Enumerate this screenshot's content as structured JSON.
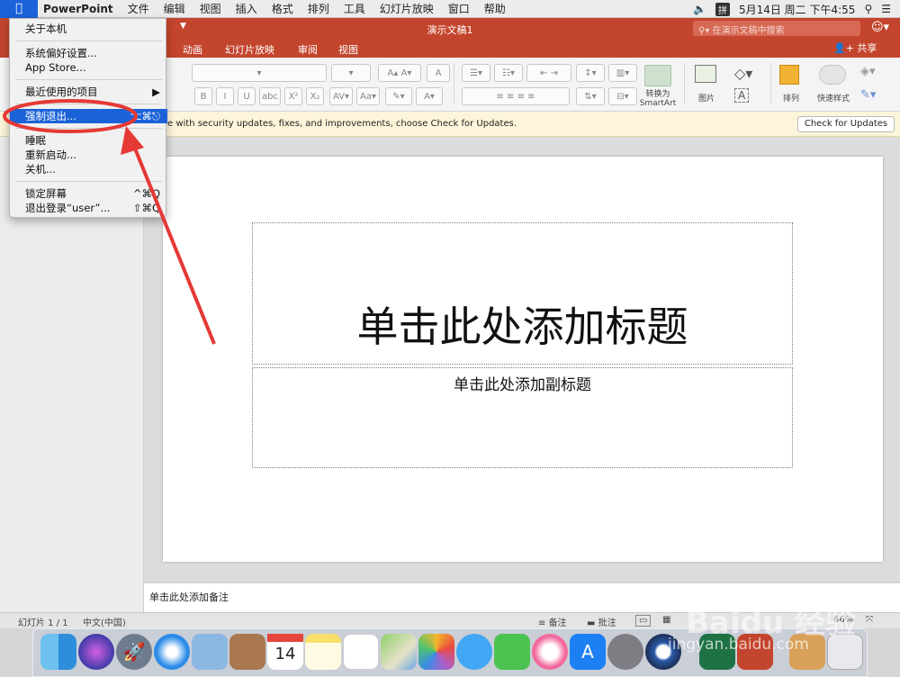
{
  "menubar": {
    "app_name": "PowerPoint",
    "items": [
      "文件",
      "编辑",
      "视图",
      "插入",
      "格式",
      "排列",
      "工具",
      "幻灯片放映",
      "窗口",
      "帮助"
    ],
    "input_method": "拼",
    "datetime": "5月14日 周二 下午4:55"
  },
  "window": {
    "title": "演示文稿1",
    "search_placeholder": "在演示文稿中搜索",
    "share_label": "共享"
  },
  "ribbon": {
    "tabs": [
      "动画",
      "幻灯片放映",
      "审阅",
      "视图"
    ],
    "labels": {
      "convert_smartart": "转换为\nSmartArt",
      "picture": "图片",
      "arrange": "排列",
      "quick_styles": "快速样式"
    },
    "format_buttons": [
      "B",
      "I",
      "U",
      "abc",
      "X²",
      "X₂"
    ]
  },
  "update_bar": {
    "message": "e with security updates, fixes, and improvements, choose Check for Updates.",
    "button": "Check for Updates"
  },
  "slide": {
    "title_placeholder": "单击此处添加标题",
    "subtitle_placeholder": "单击此处添加副标题"
  },
  "notes_placeholder": "单击此处添加备注",
  "status": {
    "slide_counter": "幻灯片 1 / 1",
    "language": "中文(中国)",
    "notes_label": "备注",
    "comments_label": "批注",
    "zoom": "66%"
  },
  "apple_menu": {
    "items": [
      {
        "label": "关于本机",
        "shortcut": ""
      },
      {
        "label": "系统偏好设置...",
        "shortcut": ""
      },
      {
        "label": "App Store...",
        "shortcut": ""
      },
      {
        "label": "最近使用的项目",
        "shortcut": "▶"
      },
      {
        "label": "强制退出...",
        "shortcut": "⌥⌘⎋"
      },
      {
        "label": "睡眠",
        "shortcut": ""
      },
      {
        "label": "重新启动...",
        "shortcut": ""
      },
      {
        "label": "关机...",
        "shortcut": ""
      },
      {
        "label": "锁定屏幕",
        "shortcut": "^⌘Q"
      },
      {
        "label": "退出登录“user”...",
        "shortcut": "⇧⌘Q"
      }
    ],
    "highlighted": "强制退出..."
  },
  "dock": {
    "calendar_day": "14",
    "apps": [
      "finder-icon",
      "siri-icon",
      "launchpad-icon",
      "safari-icon",
      "mail-icon",
      "contacts-icon",
      "calendar-icon",
      "notes-icon",
      "reminders-icon",
      "maps-icon",
      "photos-icon",
      "messages-icon",
      "facetime-icon",
      "music-icon",
      "app-store-icon",
      "system-preferences-icon",
      "quicktime-icon",
      "excel-icon",
      "powerpoint-icon",
      "downloads-icon",
      "trash-icon"
    ]
  },
  "watermark": {
    "brand": "Baidu 经验",
    "url": "jingyan.baidu.com"
  },
  "colors": {
    "accent": "#c4452d",
    "highlight": "#1b62d8",
    "annotation": "#e53935"
  }
}
